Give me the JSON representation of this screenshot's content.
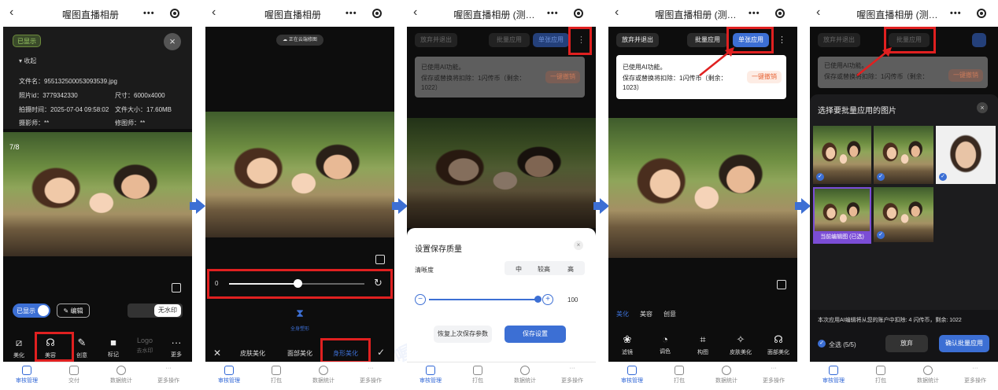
{
  "colors": {
    "accent": "#3c6fd4",
    "highlight": "#e02020",
    "panel_bg": "#0d0d0d",
    "warn": "#e8673a"
  },
  "panels": [
    {
      "title": "喔图直播相册",
      "info": {
        "status_badge": "已显示",
        "collapse": "收起",
        "filename": "文件名：955132500053093539.jpg",
        "photo_id": "照片id：3779342330",
        "size": "尺寸：6000x4000",
        "shot_time": "拍摄时间：2025-07-04 09:58:02",
        "file_size": "文件大小：17.60MB",
        "photographer": "摄影师：**",
        "retoucher": "修图师：**"
      },
      "counter": "7/8",
      "toggle_label": "已显示",
      "edit_label": "编辑",
      "watermark_toggle": "无水印",
      "tools": [
        {
          "icon": "beautify-icon",
          "glyph": "⧄",
          "label": "美化"
        },
        {
          "icon": "face-beauty-icon",
          "glyph": "☊",
          "label": "美容"
        },
        {
          "icon": "creative-icon",
          "glyph": "✎",
          "label": "创意"
        },
        {
          "icon": "mark-icon",
          "glyph": "■",
          "label": "标记"
        },
        {
          "icon": "logo-icon",
          "glyph": "Logo",
          "label": "去水印"
        },
        {
          "icon": "more-icon",
          "glyph": "···",
          "label": "更多"
        }
      ],
      "nav": [
        "审核管理",
        "交付",
        "数据统计",
        "更多操作"
      ]
    },
    {
      "title": "喔图直播相册",
      "cloud_badge": "正在云端修图",
      "slider_min": "0",
      "body_shape_label": "全身塑形",
      "tabs": [
        "皮肤美化",
        "面部美化",
        "身形美化"
      ],
      "nav": [
        "审核管理",
        "打包",
        "数据统计",
        "更多操作"
      ]
    },
    {
      "title": "喔图直播相册 (测…",
      "exit_button": "放弃并退出",
      "batch_button": "批量应用",
      "single_button": "单张应用",
      "notice_line1": "已使用AI功能。",
      "notice_line2": "保存或替换将扣除：1闪传币（剩余：1022）",
      "undo_button": "一键撤销",
      "sheet": {
        "title": "设置保存质量",
        "clarity_label": "清晰度",
        "levels": [
          "中",
          "较高",
          "高"
        ],
        "value": "100",
        "restore_button": "恢复上次保存参数",
        "save_button": "保存设置"
      },
      "nav": [
        "审核管理",
        "打包",
        "数据统计",
        "更多操作"
      ]
    },
    {
      "title": "喔图直播相册 (测…",
      "exit_button": "放弃并退出",
      "batch_button": "批量应用",
      "single_button": "单张应用",
      "notice_line1": "已使用AI功能。",
      "notice_line2": "保存或替换将扣除：1闪传币（剩余：1023）",
      "undo_button": "一键撤销",
      "tabs": [
        "美化",
        "美容",
        "创意"
      ],
      "tools": [
        {
          "icon": "filter-icon",
          "glyph": "❀",
          "label": "滤镜"
        },
        {
          "icon": "color-icon",
          "glyph": "◔",
          "label": "调色"
        },
        {
          "icon": "crop-icon",
          "glyph": "⌗",
          "label": "构图"
        },
        {
          "icon": "skin-ai-icon",
          "glyph": "✧",
          "label": "皮肤美化"
        },
        {
          "icon": "face-ai-icon",
          "glyph": "☊",
          "label": "面部美化"
        }
      ],
      "nav": [
        "审核管理",
        "打包",
        "数据统计",
        "更多操作"
      ]
    },
    {
      "title": "喔图直播相册 (测…",
      "exit_button": "放弃并退出",
      "batch_button": "批量应用",
      "notice_line1": "已使用AI功能。",
      "notice_line2": "保存或替换将扣除：1闪传币（剩余：",
      "undo_button": "一键撤销",
      "sheet_title": "选择要批量应用的图片",
      "current_label": "当前编辑图 (已选)",
      "deduct_text": "本次应用AI编辑将从您的账户中扣除: 4 闪传币，剩余: 1022",
      "select_all": "全选 (5/5)",
      "discard_button": "放弃",
      "confirm_button": "确认批量应用",
      "nav": [
        "审核管理",
        "打包",
        "数据统计",
        "更多操作"
      ]
    }
  ]
}
